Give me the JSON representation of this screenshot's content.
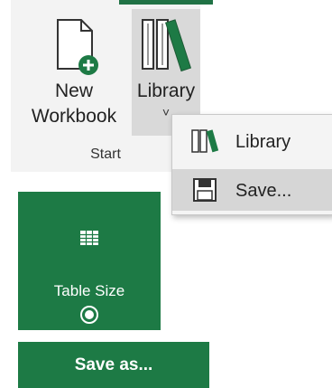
{
  "ribbon": {
    "group_label": "Start",
    "new_button": {
      "line1": "New",
      "line2": "Workbook",
      "icon": "new-workbook-icon"
    },
    "library_button": {
      "label": "Library",
      "icon": "library-books-icon",
      "chevron": "˅"
    }
  },
  "dropdown": {
    "items": [
      {
        "label": "Library",
        "icon": "library-books-icon"
      },
      {
        "label": "Save...",
        "icon": "floppy-disk-icon"
      }
    ]
  },
  "tile": {
    "label": "Table Size",
    "icon": "table-icon"
  },
  "save_as_button": {
    "label": "Save as..."
  },
  "colors": {
    "accent": "#1d7a45",
    "ribbon_bg": "#f3f3f3",
    "menu_bg": "#f4f4f4"
  }
}
